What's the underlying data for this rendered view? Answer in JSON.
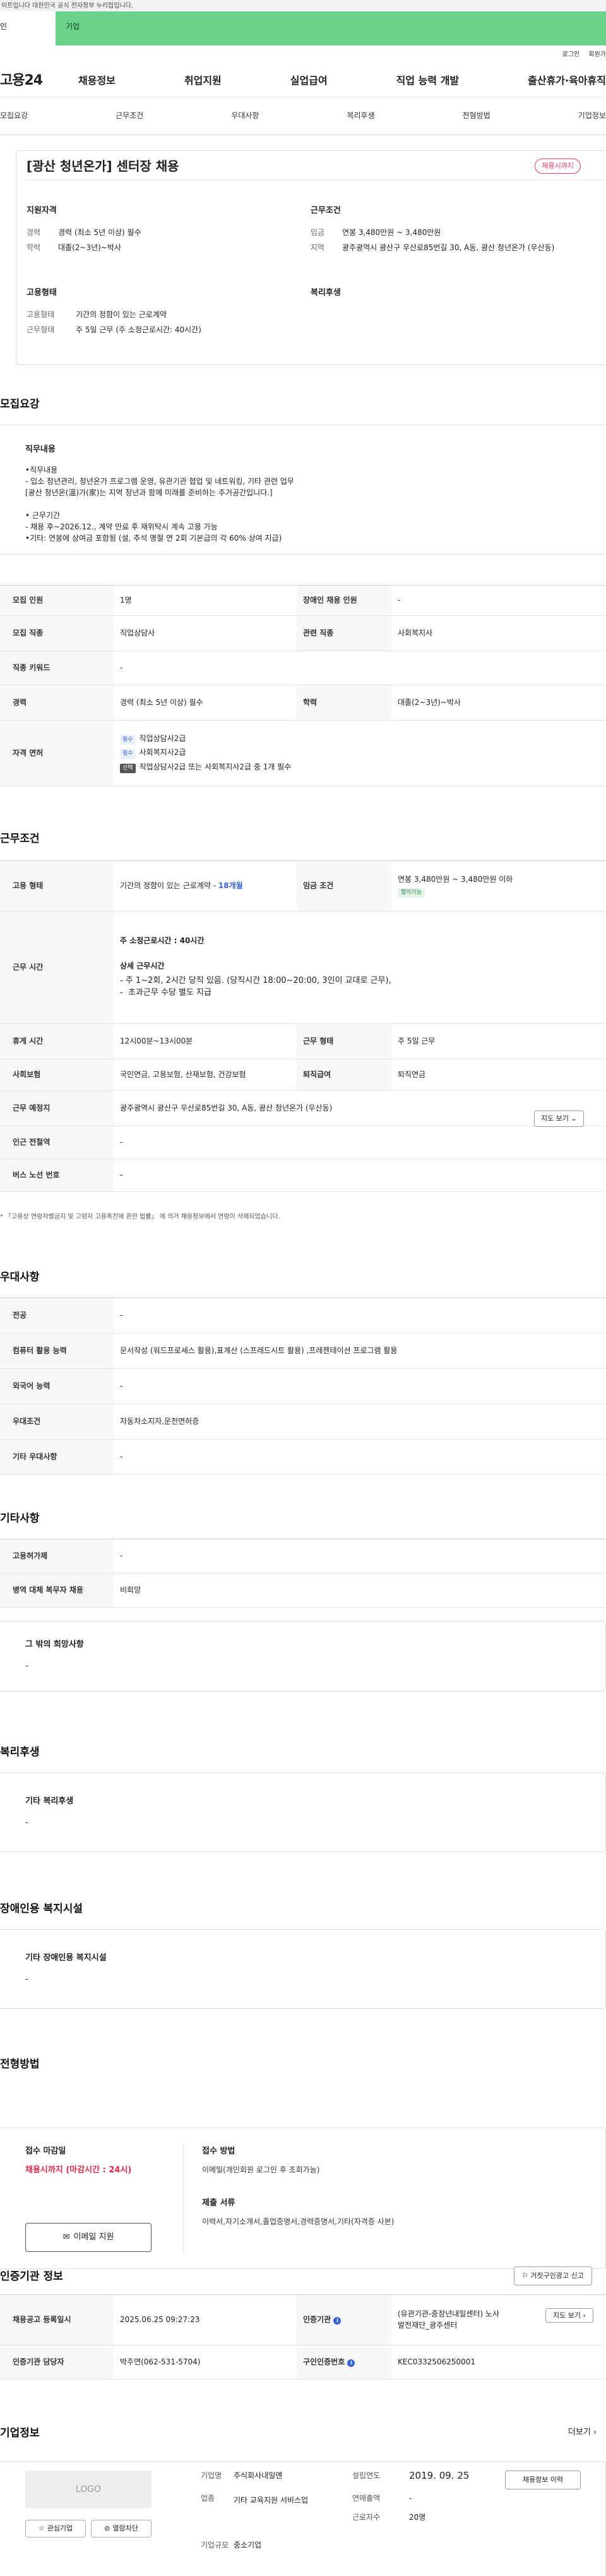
{
  "top": {
    "gov_notice": "이트입니다 대한민국 공식 전자정부 누리집입니다.",
    "tab_individual": "인",
    "tab_company": "기업"
  },
  "util": {
    "login": "로그인",
    "join": "회원가"
  },
  "gnb": {
    "logo": "고용24",
    "menu": [
      "채용정보",
      "취업지원",
      "실업급여",
      "직업 능력 개발",
      "출산휴가·육아휴직"
    ]
  },
  "subnav": [
    "모집요강",
    "근무조건",
    "우대사항",
    "복리후생",
    "전형방법",
    "기업정보"
  ],
  "summary": {
    "title": "[광산 청년온가] 센터장 채용",
    "badge": "채용시까지",
    "qual": {
      "h": "지원자격",
      "career_k": "경력",
      "career_v": "경력 (최소 5년 이상) 필수",
      "edu_k": "학력",
      "edu_v": "대졸(2~3년)~박사"
    },
    "work": {
      "h": "근무조건",
      "wage_k": "임금",
      "wage_v": "연봉 3,480만원 ~ 3,480만원",
      "loc_k": "지역",
      "loc_v": "광주광역시 광산구 우산로85번길 30, A동, 광산 청년온가 (우산동)"
    },
    "form": {
      "h": "고용형태",
      "type_k": "고용형태",
      "type_v": "기간의 정함이 있는 근로계약",
      "hours_k": "근무형태",
      "hours_v": "주 5일 근무 (주 소정근로시간: 40시간)"
    },
    "welfare": {
      "h": "복리후생"
    }
  },
  "recruit": {
    "title": "모집요강",
    "job_h": "직무내용",
    "job_text": "•직무내용\n- 입소 청년관리, 청년온가 프로그램 운영, 유관기관 협업 및 네트워킹, 기타 관련 업무\n[광산 청년온(溫)가(家)는 지역 청년과 함께 미래를 준비하는 주거공간입니다.]\n\n• 근무기간\n- 채용 후~2026.12., 계약 만료 후 재위탁시 계속 고용 가능\n•기타: 연봉에 상여금 포함됨 (설, 추석 명절 연 2회 기본급의 각 60% 상여 지급)",
    "rows": {
      "count_k": "모집 인원",
      "count_v": "1명",
      "dis_k": "장애인 채용 인원",
      "dis_v": "-",
      "job_k": "모집 직종",
      "job_v": "직업상담사",
      "rel_k": "관련 직종",
      "rel_v": "사회복지사",
      "kw_k": "직종 키워드",
      "kw_v": "-",
      "car_k": "경력",
      "car_v": "경력 (최소 5년 이상) 필수",
      "edu_k": "학력",
      "edu_v": "대졸(2~3년)~박사",
      "lic_k": "자격 면허",
      "lic": [
        {
          "tag": "필수",
          "name": "직업상담사2급"
        },
        {
          "tag": "필수",
          "name": "사회복지사2급"
        },
        {
          "tag": "선택",
          "name": "직업상담사2급 또는 사회복지사2급 중 1개 필수"
        }
      ]
    }
  },
  "cond": {
    "title": "근무조건",
    "type_k": "고용 형태",
    "type_v": "기간의 정함이 있는 근로계약 - ",
    "type_months": "18개월",
    "wage_k": "임금 조건",
    "wage_v": "연봉 3,480만원 ~ 3,480만원 이하",
    "wage_tag": "협의가능",
    "time_k": "근무 시간",
    "time_main": "주 소정근로시간 : 40시간",
    "time_detail_h": "상세 근무시간",
    "time_detail": [
      "주 1~2회, 2시간 당직 있음. (당직시간 18:00~20:00, 3인이 교대로 근무),",
      "초과근무 수당 별도 지급"
    ],
    "rest_k": "휴게 시간",
    "rest_v": "12시00분~13시00분",
    "shift_k": "근무 형태",
    "shift_v": "주 5일 근무",
    "ins_k": "사회보험",
    "ins_v": "국민연금, 고용보험, 산재보험, 건강보험",
    "ret_k": "퇴직급여",
    "ret_v": "퇴직연금",
    "place_k": "근무 예정지",
    "place_v": "광주광역시 광산구 우산로85번길 30, A동, 광산 청년온가 (우산동)",
    "map_btn": "지도 보기",
    "sub_k": "인근 전철역",
    "sub_v": "-",
    "bus_k": "버스 노선 번호",
    "bus_v": "-",
    "note": "* 「고용상 연령차별금지 및 고령자 고용촉진에 관한 법률」 에 의거 채용정보에서 연령이 삭제되었습니다."
  },
  "pref": {
    "title": "우대사항",
    "major_k": "전공",
    "major_v": "-",
    "pc_k": "컴퓨터 활용 능력",
    "pc_v": "문서작성 (워드프로세스 활용),표계산 (스프레드시트 활용) ,프레젠테이션 프로그램 활용",
    "lang_k": "외국어 능력",
    "lang_v": "-",
    "cond_k": "우대조건",
    "cond_v": "자동차소지자,운전면허증",
    "etc_k": "기타 우대사항",
    "etc_v": "-"
  },
  "etc": {
    "title": "기타사항",
    "support_k": "고용허가제",
    "support_v": "-",
    "mil_k": "병역 대체 복무자 채용",
    "mil_v": "비희망",
    "wish_h": "그 밖의 희망사항",
    "wish_v": "-"
  },
  "welfare": {
    "title": "복리후생",
    "h": "기타 복리후생",
    "v": "-"
  },
  "disfac": {
    "title": "장애인용 복지시설",
    "h": "기타 장애인용 복지시설",
    "v": "-"
  },
  "process": {
    "title": "전형방법",
    "deadline_h": "접수 마감일",
    "deadline_v": "채용시까지 (마감시간 : 24시)",
    "method_h": "접수 방법",
    "method_v": "이메일(개인회원 로그인 후 조회가능)",
    "docs_h": "제출 서류",
    "docs_v": "이력서,자기소개서,졸업증명서,경력증명서,기타(자격증 사본)",
    "email_btn": "이메일 지원"
  },
  "agency": {
    "title": "인증기관 정보",
    "report_btn": "거짓구인광고 신고",
    "reg_k": "채용공고 등록일시",
    "reg_v": "2025.06.25 09:27:23",
    "org_k": "인증기관",
    "org_v": "(유관기관-중장년내일센터) 노사발전재단_광주센터",
    "map_btn": "지도 보기",
    "mgr_k": "인증기관 담당자",
    "mgr_v": "박주연(062-531-5704)",
    "no_k": "구인인증번호",
    "no_v": "KEC0332506250001"
  },
  "company": {
    "title": "기업정보",
    "more": "더보기",
    "logo": "LOGO",
    "fav_btn": "관심기업",
    "block_btn": "열람차단",
    "name_k": "기업명",
    "name_v": "주식회사내일엔",
    "ind_k": "업종",
    "ind_v": "기타 교육지원 서비스업",
    "size_k": "기업규모",
    "size_v": "중소기업",
    "est_k": "설립연도",
    "est_v": "2019. 09. 25",
    "sales_k": "연매출액",
    "sales_v": "-",
    "emp_k": "근로자수",
    "emp_v": "20명",
    "jobs_btn": "채용정보 이력"
  },
  "colors": {
    "accent_green": "#6ad18a",
    "badge_red": "#e83c64",
    "link_blue": "#3a63d6"
  }
}
